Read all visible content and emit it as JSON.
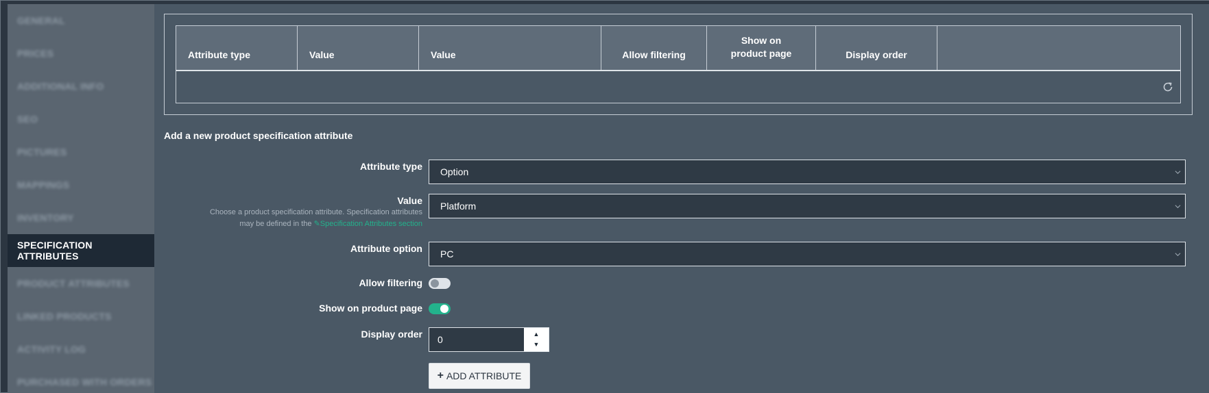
{
  "sidebar": {
    "items": [
      {
        "label": "GENERAL"
      },
      {
        "label": "PRICES"
      },
      {
        "label": "ADDITIONAL INFO"
      },
      {
        "label": "SEO"
      },
      {
        "label": "PICTURES"
      },
      {
        "label": "MAPPINGS"
      },
      {
        "label": "INVENTORY"
      },
      {
        "label": "SPECIFICATION ATTRIBUTES"
      },
      {
        "label": "PRODUCT ATTRIBUTES"
      },
      {
        "label": "LINKED PRODUCTS"
      },
      {
        "label": "ACTIVITY LOG"
      },
      {
        "label": "PURCHASED WITH ORDERS"
      }
    ],
    "active_index": 7,
    "active_color": "#23b28c"
  },
  "grid": {
    "columns": [
      "Attribute type",
      "Value",
      "Value",
      "Allow filtering",
      "Show on product page",
      "Display order",
      ""
    ],
    "rows": [],
    "refresh_icon": "refresh-icon"
  },
  "form": {
    "title": "Add a new product specification attribute",
    "attribute_type": {
      "label": "Attribute type",
      "value": "Option"
    },
    "value": {
      "label": "Value",
      "hint_line1": "Choose a product specification attribute. Specification attributes",
      "hint_line2_prefix": "may be defined in the ",
      "hint_link": "Specification Attributes section",
      "selected": "Platform"
    },
    "attribute_option": {
      "label": "Attribute option",
      "value": "PC"
    },
    "allow_filtering": {
      "label": "Allow filtering",
      "checked": false
    },
    "show_on_product_page": {
      "label": "Show on product page",
      "checked": true
    },
    "display_order": {
      "label": "Display order",
      "value": "0"
    },
    "add_button": {
      "label": "ADD ATTRIBUTE"
    }
  }
}
